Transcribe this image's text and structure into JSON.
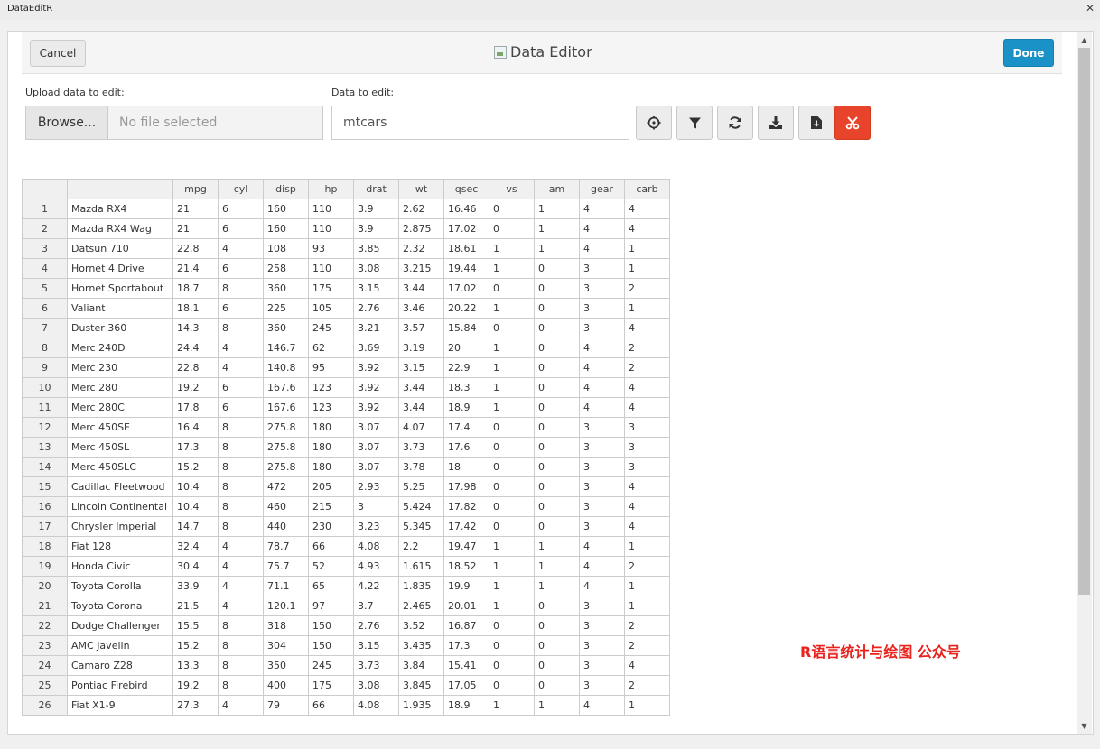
{
  "window": {
    "title": "DataEditR",
    "close_glyph": "✕"
  },
  "gadget": {
    "title": "Data Editor",
    "cancel_label": "Cancel",
    "done_label": "Done"
  },
  "upload": {
    "label": "Upload data to edit:",
    "browse_label": "Browse...",
    "placeholder": "No file selected"
  },
  "data_select": {
    "label": "Data to edit:",
    "value": "mtcars"
  },
  "toolbar": {
    "icons": [
      "crosshair-icon",
      "filter-icon",
      "sync-icon",
      "download-icon",
      "file-download-icon",
      "cut-icon"
    ],
    "accent_red": "#e8432b"
  },
  "colors": {
    "done_blue": "#1a92c7",
    "watermark_red": "#e8231e"
  },
  "watermark": "R语言统计与绘图 公众号",
  "table": {
    "columns": [
      "",
      "",
      "mpg",
      "cyl",
      "disp",
      "hp",
      "drat",
      "wt",
      "qsec",
      "vs",
      "am",
      "gear",
      "carb"
    ],
    "rows": [
      [
        "1",
        "Mazda RX4",
        "21",
        "6",
        "160",
        "110",
        "3.9",
        "2.62",
        "16.46",
        "0",
        "1",
        "4",
        "4"
      ],
      [
        "2",
        "Mazda RX4 Wag",
        "21",
        "6",
        "160",
        "110",
        "3.9",
        "2.875",
        "17.02",
        "0",
        "1",
        "4",
        "4"
      ],
      [
        "3",
        "Datsun 710",
        "22.8",
        "4",
        "108",
        "93",
        "3.85",
        "2.32",
        "18.61",
        "1",
        "1",
        "4",
        "1"
      ],
      [
        "4",
        "Hornet 4 Drive",
        "21.4",
        "6",
        "258",
        "110",
        "3.08",
        "3.215",
        "19.44",
        "1",
        "0",
        "3",
        "1"
      ],
      [
        "5",
        "Hornet Sportabout",
        "18.7",
        "8",
        "360",
        "175",
        "3.15",
        "3.44",
        "17.02",
        "0",
        "0",
        "3",
        "2"
      ],
      [
        "6",
        "Valiant",
        "18.1",
        "6",
        "225",
        "105",
        "2.76",
        "3.46",
        "20.22",
        "1",
        "0",
        "3",
        "1"
      ],
      [
        "7",
        "Duster 360",
        "14.3",
        "8",
        "360",
        "245",
        "3.21",
        "3.57",
        "15.84",
        "0",
        "0",
        "3",
        "4"
      ],
      [
        "8",
        "Merc 240D",
        "24.4",
        "4",
        "146.7",
        "62",
        "3.69",
        "3.19",
        "20",
        "1",
        "0",
        "4",
        "2"
      ],
      [
        "9",
        "Merc 230",
        "22.8",
        "4",
        "140.8",
        "95",
        "3.92",
        "3.15",
        "22.9",
        "1",
        "0",
        "4",
        "2"
      ],
      [
        "10",
        "Merc 280",
        "19.2",
        "6",
        "167.6",
        "123",
        "3.92",
        "3.44",
        "18.3",
        "1",
        "0",
        "4",
        "4"
      ],
      [
        "11",
        "Merc 280C",
        "17.8",
        "6",
        "167.6",
        "123",
        "3.92",
        "3.44",
        "18.9",
        "1",
        "0",
        "4",
        "4"
      ],
      [
        "12",
        "Merc 450SE",
        "16.4",
        "8",
        "275.8",
        "180",
        "3.07",
        "4.07",
        "17.4",
        "0",
        "0",
        "3",
        "3"
      ],
      [
        "13",
        "Merc 450SL",
        "17.3",
        "8",
        "275.8",
        "180",
        "3.07",
        "3.73",
        "17.6",
        "0",
        "0",
        "3",
        "3"
      ],
      [
        "14",
        "Merc 450SLC",
        "15.2",
        "8",
        "275.8",
        "180",
        "3.07",
        "3.78",
        "18",
        "0",
        "0",
        "3",
        "3"
      ],
      [
        "15",
        "Cadillac Fleetwood",
        "10.4",
        "8",
        "472",
        "205",
        "2.93",
        "5.25",
        "17.98",
        "0",
        "0",
        "3",
        "4"
      ],
      [
        "16",
        "Lincoln Continental",
        "10.4",
        "8",
        "460",
        "215",
        "3",
        "5.424",
        "17.82",
        "0",
        "0",
        "3",
        "4"
      ],
      [
        "17",
        "Chrysler Imperial",
        "14.7",
        "8",
        "440",
        "230",
        "3.23",
        "5.345",
        "17.42",
        "0",
        "0",
        "3",
        "4"
      ],
      [
        "18",
        "Fiat 128",
        "32.4",
        "4",
        "78.7",
        "66",
        "4.08",
        "2.2",
        "19.47",
        "1",
        "1",
        "4",
        "1"
      ],
      [
        "19",
        "Honda Civic",
        "30.4",
        "4",
        "75.7",
        "52",
        "4.93",
        "1.615",
        "18.52",
        "1",
        "1",
        "4",
        "2"
      ],
      [
        "20",
        "Toyota Corolla",
        "33.9",
        "4",
        "71.1",
        "65",
        "4.22",
        "1.835",
        "19.9",
        "1",
        "1",
        "4",
        "1"
      ],
      [
        "21",
        "Toyota Corona",
        "21.5",
        "4",
        "120.1",
        "97",
        "3.7",
        "2.465",
        "20.01",
        "1",
        "0",
        "3",
        "1"
      ],
      [
        "22",
        "Dodge Challenger",
        "15.5",
        "8",
        "318",
        "150",
        "2.76",
        "3.52",
        "16.87",
        "0",
        "0",
        "3",
        "2"
      ],
      [
        "23",
        "AMC Javelin",
        "15.2",
        "8",
        "304",
        "150",
        "3.15",
        "3.435",
        "17.3",
        "0",
        "0",
        "3",
        "2"
      ],
      [
        "24",
        "Camaro Z28",
        "13.3",
        "8",
        "350",
        "245",
        "3.73",
        "3.84",
        "15.41",
        "0",
        "0",
        "3",
        "4"
      ],
      [
        "25",
        "Pontiac Firebird",
        "19.2",
        "8",
        "400",
        "175",
        "3.08",
        "3.845",
        "17.05",
        "0",
        "0",
        "3",
        "2"
      ],
      [
        "26",
        "Fiat X1-9",
        "27.3",
        "4",
        "79",
        "66",
        "4.08",
        "1.935",
        "18.9",
        "1",
        "1",
        "4",
        "1"
      ]
    ]
  }
}
